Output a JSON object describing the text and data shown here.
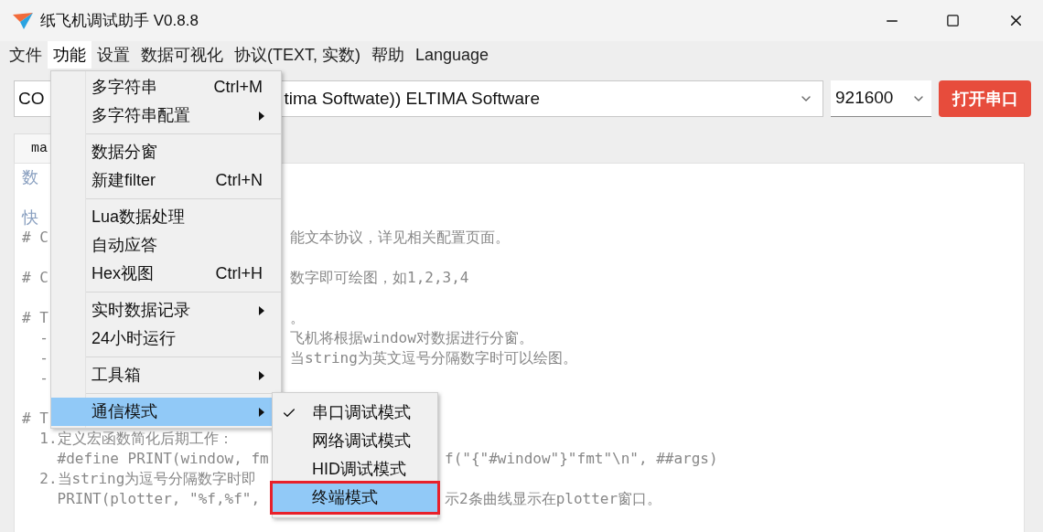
{
  "window": {
    "title": "纸飞机调试助手 V0.8.8"
  },
  "menubar": [
    {
      "label": "文件",
      "selected": false
    },
    {
      "label": "功能",
      "selected": true
    },
    {
      "label": "设置",
      "selected": false
    },
    {
      "label": "数据可视化",
      "selected": false
    },
    {
      "label": "协议(TEXT, 实数)",
      "selected": false
    },
    {
      "label": "帮助",
      "selected": false
    },
    {
      "label": "Language",
      "selected": false
    }
  ],
  "toolbar": {
    "port": "CO",
    "port_rest": "tima Softwate)) ELTIMA Software",
    "baud": "921600",
    "open_button": "打开串口"
  },
  "tabs": [
    {
      "label": "ma",
      "selected": true
    }
  ],
  "editor_lines": [
    {
      "left": "数",
      "kind": "heading"
    },
    {
      "kind": "blank"
    },
    {
      "left": "快",
      "kind": "heading"
    },
    {
      "left": "# C",
      "right": "能文本协议，详见相关配置页面。",
      "kind": "after_menu"
    },
    {
      "kind": "blank"
    },
    {
      "left": "# C",
      "right": "数字即可绘图，如1,2,3,4",
      "kind": "after_menu"
    },
    {
      "kind": "blank"
    },
    {
      "left": "# T",
      "right": "。",
      "kind": "after_menu"
    },
    {
      "left": "  -",
      "right": "飞机将根据window对数据进行分窗。",
      "kind": "after_menu"
    },
    {
      "left": "  -",
      "right": "当string为英文逗号分隔数字时可以绘图。",
      "kind": "after_menu"
    },
    {
      "left": "  -",
      "kind": "after_menu"
    },
    {
      "kind": "blank"
    },
    {
      "left": "# T",
      "kind": "after_menu"
    },
    {
      "left": "  1.定义宏函数简化后期工作：",
      "kind": "after_menu"
    },
    {
      "left": "    #define PRINT(window, fm",
      "right": "f(\"{\"#window\"}\"fmt\"\\n\", ##args)",
      "kind": "after_submenu"
    },
    {
      "left": "  2.当string为逗号分隔数字时即",
      "kind": "after_submenu"
    },
    {
      "left": "    PRINT(plotter, \"%f,%f\",",
      "right": "示2条曲线显示在plotter窗口。",
      "kind": "after_submenu"
    }
  ],
  "menu": {
    "groups": [
      [
        {
          "label": "多字符串",
          "shortcut": "Ctrl+M",
          "submenu": false,
          "selected": false
        },
        {
          "label": "多字符串配置",
          "submenu": true,
          "selected": false
        }
      ],
      [
        {
          "label": "数据分窗",
          "submenu": false,
          "selected": false
        },
        {
          "label": "新建filter",
          "shortcut": "Ctrl+N",
          "submenu": false,
          "selected": false
        }
      ],
      [
        {
          "label": "Lua数据处理",
          "submenu": false,
          "selected": false
        },
        {
          "label": "自动应答",
          "submenu": false,
          "selected": false
        },
        {
          "label": "Hex视图",
          "shortcut": "Ctrl+H",
          "submenu": false,
          "selected": false
        }
      ],
      [
        {
          "label": "实时数据记录",
          "submenu": true,
          "selected": false
        },
        {
          "label": "24小时运行",
          "submenu": false,
          "selected": false
        }
      ],
      [
        {
          "label": "工具箱",
          "submenu": true,
          "selected": false
        }
      ],
      [
        {
          "label": "通信模式",
          "submenu": true,
          "selected": true
        }
      ]
    ]
  },
  "submenu": [
    {
      "label": "串口调试模式",
      "checked": true,
      "selected": false,
      "annotated": false
    },
    {
      "label": "网络调试模式",
      "checked": false,
      "selected": false,
      "annotated": false
    },
    {
      "label": "HID调试模式",
      "checked": false,
      "selected": false,
      "annotated": false
    },
    {
      "label": "终端模式",
      "checked": false,
      "selected": true,
      "annotated": true
    }
  ]
}
